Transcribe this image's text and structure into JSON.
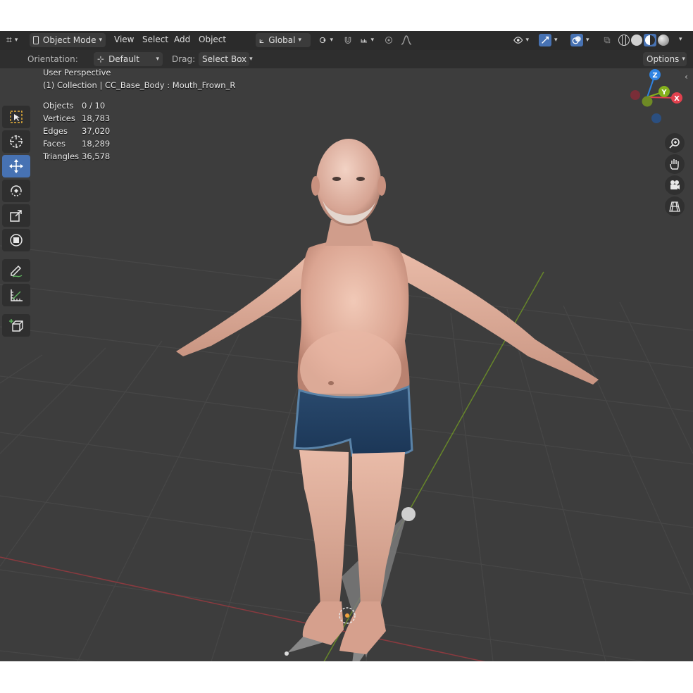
{
  "header": {
    "editor_type": "editor-type-icon",
    "mode": "Object Mode",
    "menus": [
      "View",
      "Select",
      "Add",
      "Object"
    ],
    "transform_orientation": "Global"
  },
  "tool_settings": {
    "orientation_label": "Orientation:",
    "orientation_value": "Default",
    "drag_label": "Drag:",
    "drag_value": "Select Box",
    "options_label": "Options"
  },
  "toolbar": {
    "tools": [
      "select-box-icon",
      "cursor-icon",
      "move-icon",
      "rotate-icon",
      "scale-icon",
      "transform-icon",
      "annotate-icon",
      "measure-icon",
      "add-cube-icon"
    ],
    "active_tool": "move-icon"
  },
  "viewport": {
    "view_name": "User Perspective",
    "collection_info": "(1) Collection | CC_Base_Body : Mouth_Frown_R",
    "stats": [
      {
        "label": "Objects",
        "value": "0 / 10"
      },
      {
        "label": "Vertices",
        "value": "18,783"
      },
      {
        "label": "Edges",
        "value": "37,020"
      },
      {
        "label": "Faces",
        "value": "18,289"
      },
      {
        "label": "Triangles",
        "value": "36,578"
      }
    ],
    "gizmo": {
      "z": "Z",
      "y": "Y",
      "x": "X"
    }
  },
  "colors": {
    "accent": "#4772b3",
    "x_axis": "#e2414e",
    "y_axis": "#84b11c",
    "z_axis": "#2f83e2",
    "background": "#3d3d3d",
    "header": "#2b2b2b"
  }
}
